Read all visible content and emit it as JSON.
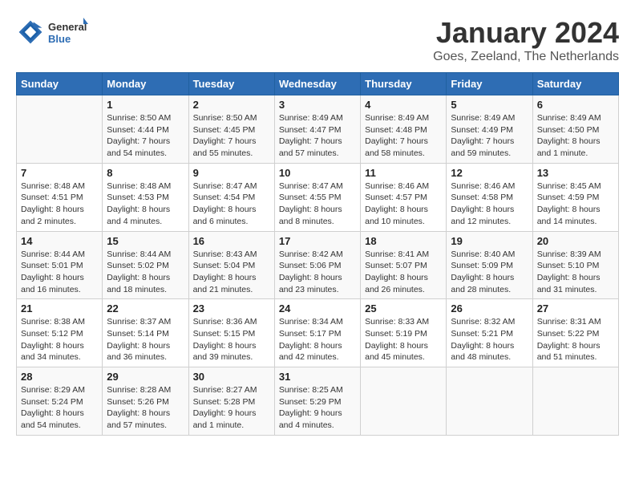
{
  "header": {
    "logo_general": "General",
    "logo_blue": "Blue",
    "title": "January 2024",
    "subtitle": "Goes, Zeeland, The Netherlands"
  },
  "days_of_week": [
    "Sunday",
    "Monday",
    "Tuesday",
    "Wednesday",
    "Thursday",
    "Friday",
    "Saturday"
  ],
  "weeks": [
    [
      {
        "day": "",
        "info": ""
      },
      {
        "day": "1",
        "info": "Sunrise: 8:50 AM\nSunset: 4:44 PM\nDaylight: 7 hours\nand 54 minutes."
      },
      {
        "day": "2",
        "info": "Sunrise: 8:50 AM\nSunset: 4:45 PM\nDaylight: 7 hours\nand 55 minutes."
      },
      {
        "day": "3",
        "info": "Sunrise: 8:49 AM\nSunset: 4:47 PM\nDaylight: 7 hours\nand 57 minutes."
      },
      {
        "day": "4",
        "info": "Sunrise: 8:49 AM\nSunset: 4:48 PM\nDaylight: 7 hours\nand 58 minutes."
      },
      {
        "day": "5",
        "info": "Sunrise: 8:49 AM\nSunset: 4:49 PM\nDaylight: 7 hours\nand 59 minutes."
      },
      {
        "day": "6",
        "info": "Sunrise: 8:49 AM\nSunset: 4:50 PM\nDaylight: 8 hours\nand 1 minute."
      }
    ],
    [
      {
        "day": "7",
        "info": "Sunrise: 8:48 AM\nSunset: 4:51 PM\nDaylight: 8 hours\nand 2 minutes."
      },
      {
        "day": "8",
        "info": "Sunrise: 8:48 AM\nSunset: 4:53 PM\nDaylight: 8 hours\nand 4 minutes."
      },
      {
        "day": "9",
        "info": "Sunrise: 8:47 AM\nSunset: 4:54 PM\nDaylight: 8 hours\nand 6 minutes."
      },
      {
        "day": "10",
        "info": "Sunrise: 8:47 AM\nSunset: 4:55 PM\nDaylight: 8 hours\nand 8 minutes."
      },
      {
        "day": "11",
        "info": "Sunrise: 8:46 AM\nSunset: 4:57 PM\nDaylight: 8 hours\nand 10 minutes."
      },
      {
        "day": "12",
        "info": "Sunrise: 8:46 AM\nSunset: 4:58 PM\nDaylight: 8 hours\nand 12 minutes."
      },
      {
        "day": "13",
        "info": "Sunrise: 8:45 AM\nSunset: 4:59 PM\nDaylight: 8 hours\nand 14 minutes."
      }
    ],
    [
      {
        "day": "14",
        "info": "Sunrise: 8:44 AM\nSunset: 5:01 PM\nDaylight: 8 hours\nand 16 minutes."
      },
      {
        "day": "15",
        "info": "Sunrise: 8:44 AM\nSunset: 5:02 PM\nDaylight: 8 hours\nand 18 minutes."
      },
      {
        "day": "16",
        "info": "Sunrise: 8:43 AM\nSunset: 5:04 PM\nDaylight: 8 hours\nand 21 minutes."
      },
      {
        "day": "17",
        "info": "Sunrise: 8:42 AM\nSunset: 5:06 PM\nDaylight: 8 hours\nand 23 minutes."
      },
      {
        "day": "18",
        "info": "Sunrise: 8:41 AM\nSunset: 5:07 PM\nDaylight: 8 hours\nand 26 minutes."
      },
      {
        "day": "19",
        "info": "Sunrise: 8:40 AM\nSunset: 5:09 PM\nDaylight: 8 hours\nand 28 minutes."
      },
      {
        "day": "20",
        "info": "Sunrise: 8:39 AM\nSunset: 5:10 PM\nDaylight: 8 hours\nand 31 minutes."
      }
    ],
    [
      {
        "day": "21",
        "info": "Sunrise: 8:38 AM\nSunset: 5:12 PM\nDaylight: 8 hours\nand 34 minutes."
      },
      {
        "day": "22",
        "info": "Sunrise: 8:37 AM\nSunset: 5:14 PM\nDaylight: 8 hours\nand 36 minutes."
      },
      {
        "day": "23",
        "info": "Sunrise: 8:36 AM\nSunset: 5:15 PM\nDaylight: 8 hours\nand 39 minutes."
      },
      {
        "day": "24",
        "info": "Sunrise: 8:34 AM\nSunset: 5:17 PM\nDaylight: 8 hours\nand 42 minutes."
      },
      {
        "day": "25",
        "info": "Sunrise: 8:33 AM\nSunset: 5:19 PM\nDaylight: 8 hours\nand 45 minutes."
      },
      {
        "day": "26",
        "info": "Sunrise: 8:32 AM\nSunset: 5:21 PM\nDaylight: 8 hours\nand 48 minutes."
      },
      {
        "day": "27",
        "info": "Sunrise: 8:31 AM\nSunset: 5:22 PM\nDaylight: 8 hours\nand 51 minutes."
      }
    ],
    [
      {
        "day": "28",
        "info": "Sunrise: 8:29 AM\nSunset: 5:24 PM\nDaylight: 8 hours\nand 54 minutes."
      },
      {
        "day": "29",
        "info": "Sunrise: 8:28 AM\nSunset: 5:26 PM\nDaylight: 8 hours\nand 57 minutes."
      },
      {
        "day": "30",
        "info": "Sunrise: 8:27 AM\nSunset: 5:28 PM\nDaylight: 9 hours\nand 1 minute."
      },
      {
        "day": "31",
        "info": "Sunrise: 8:25 AM\nSunset: 5:29 PM\nDaylight: 9 hours\nand 4 minutes."
      },
      {
        "day": "",
        "info": ""
      },
      {
        "day": "",
        "info": ""
      },
      {
        "day": "",
        "info": ""
      }
    ]
  ]
}
